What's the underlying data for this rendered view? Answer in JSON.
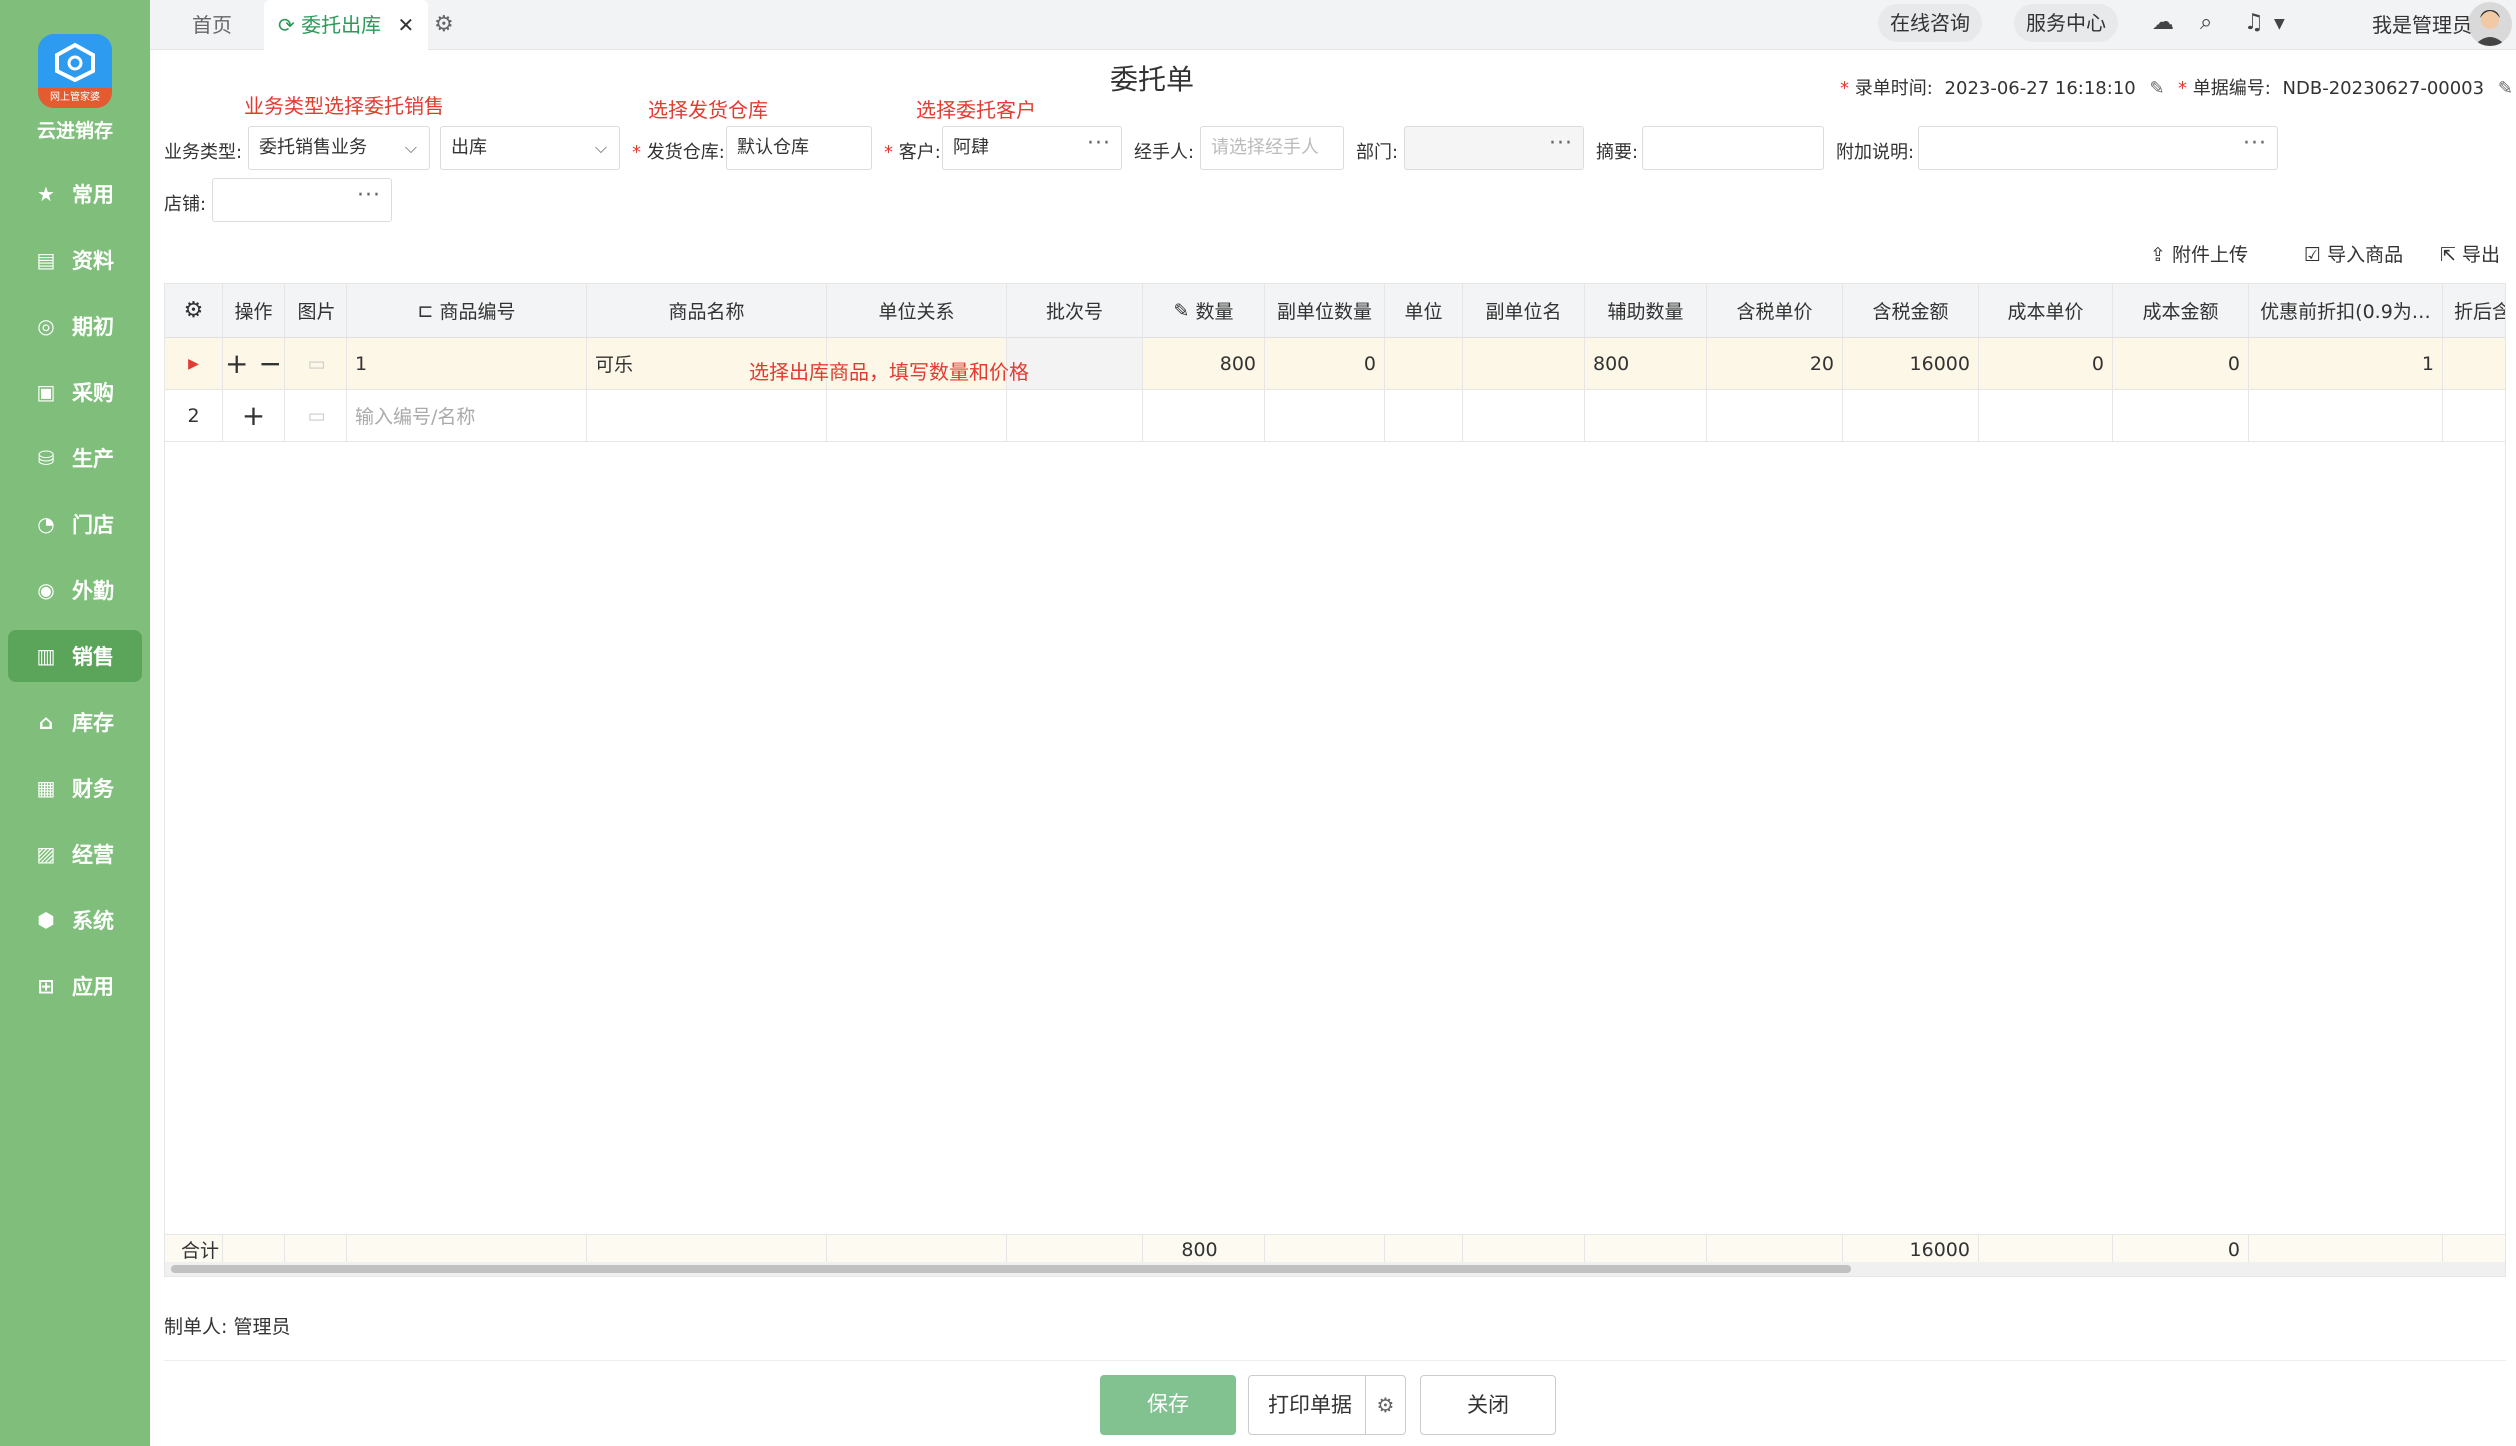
{
  "sidebar": {
    "logo_strip": "网上管家婆",
    "logo_name": "云进销存",
    "items": [
      {
        "icon": "star-icon",
        "glyph": "★",
        "label": "常用"
      },
      {
        "icon": "document-icon",
        "glyph": "▤",
        "label": "资料"
      },
      {
        "icon": "target-icon",
        "glyph": "◎",
        "label": "期初"
      },
      {
        "icon": "purchase-icon",
        "glyph": "▣",
        "label": "采购"
      },
      {
        "icon": "production-icon",
        "glyph": "⛁",
        "label": "生产"
      },
      {
        "icon": "pie-icon",
        "glyph": "◔",
        "label": "门店"
      },
      {
        "icon": "field-icon",
        "glyph": "◉",
        "label": "外勤"
      },
      {
        "icon": "bar-chart-icon",
        "glyph": "▥",
        "label": "销售"
      },
      {
        "icon": "warehouse-icon",
        "glyph": "⌂",
        "label": "库存"
      },
      {
        "icon": "finance-icon",
        "glyph": "▦",
        "label": "财务"
      },
      {
        "icon": "operation-icon",
        "glyph": "▨",
        "label": "经营"
      },
      {
        "icon": "hexagon-icon",
        "glyph": "⬢",
        "label": "系统"
      },
      {
        "icon": "plus-square-icon",
        "glyph": "⊞",
        "label": "应用"
      }
    ]
  },
  "topbar": {
    "home_tab": "首页",
    "active_tab": "委托出库",
    "online_consult": "在线咨询",
    "service_center": "服务中心",
    "user_name": "我是管理员"
  },
  "form": {
    "title": "委托单",
    "entry_time_label": "录单时间:",
    "entry_time": "2023-06-27 16:18:10",
    "doc_no_label": "单据编号:",
    "doc_no": "NDB-20230627-00003",
    "note_business": "业务类型选择委托销售",
    "note_warehouse": "选择发货仓库",
    "note_customer": "选择委托客户",
    "business_label": "业务类型:",
    "business_value": "委托销售业务",
    "direction_value": "出库",
    "warehouse_label": "发货仓库:",
    "warehouse_value": "默认仓库",
    "customer_label": "客户:",
    "customer_value": "阿肆",
    "handler_label": "经手人:",
    "handler_placeholder": "请选择经手人",
    "dept_label": "部门:",
    "summary_label": "摘要:",
    "extra_label": "附加说明:",
    "shop_label": "店铺:"
  },
  "actions": {
    "upload": "附件上传",
    "import": "导入商品",
    "export": "导出"
  },
  "table": {
    "headers": [
      "操作",
      "图片",
      "商品编号",
      "商品名称",
      "单位关系",
      "批次号",
      "数量",
      "副单位数量",
      "单位",
      "副单位名",
      "辅助数量",
      "含税单价",
      "含税金额",
      "成本单价",
      "成本金额",
      "优惠前折扣(0.9为…",
      "折后含"
    ],
    "row1": {
      "no": "",
      "code": "1",
      "name": "可乐",
      "qty": "800",
      "sub_qty": "0",
      "aux_qty": "800",
      "price": "20",
      "amount": "16000",
      "cost_price": "0",
      "cost_amount": "0",
      "discount": "1"
    },
    "row1_note": "选择出库商品，填写数量和价格",
    "row2": {
      "no": "2",
      "placeholder": "输入编号/名称"
    },
    "sum": {
      "label": "合计",
      "qty": "800",
      "amount": "16000",
      "cost_amount": "0"
    }
  },
  "footer": {
    "maker": "制单人: 管理员",
    "save": "保存",
    "print": "打印单据",
    "close": "关闭"
  }
}
